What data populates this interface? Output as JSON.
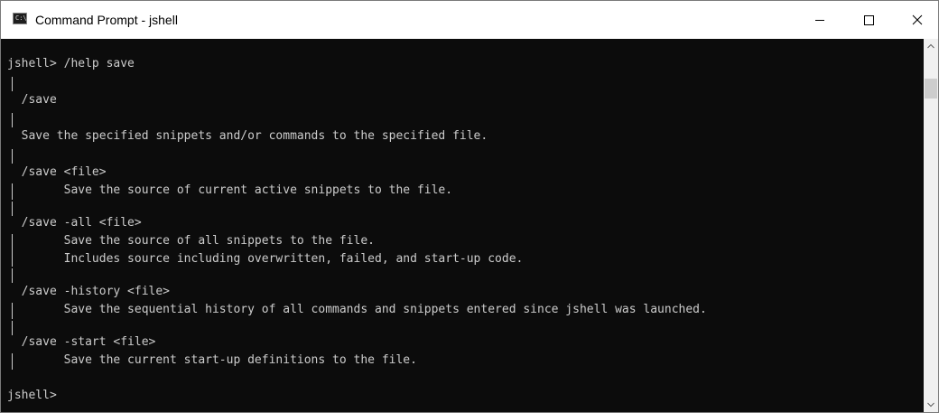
{
  "window": {
    "title": "Command Prompt - jshell",
    "icon_label": "C:\\"
  },
  "icons": {
    "minimize": "minimize-icon",
    "maximize": "maximize-icon",
    "close": "close-icon",
    "scroll_up": "chevron-up-icon",
    "scroll_down": "chevron-down-icon"
  },
  "console": {
    "lines": [
      "jshell> /help save",
      "  /save",
      "  Save the specified snippets and/or commands to the specified file.",
      "  /save <file>",
      "        Save the source of current active snippets to the file.",
      "  /save -all <file>",
      "        Save the source of all snippets to the file.",
      "        Includes source including overwritten, failed, and start-up code.",
      "  /save -history <file>",
      "        Save the sequential history of all commands and snippets entered since jshell was launched.",
      "  /save -start <file>",
      "        Save the current start-up definitions to the file.",
      "jshell>"
    ]
  },
  "colors": {
    "console_background": "#0c0c0c",
    "console_text": "#cccccc",
    "titlebar_background": "#ffffff"
  }
}
